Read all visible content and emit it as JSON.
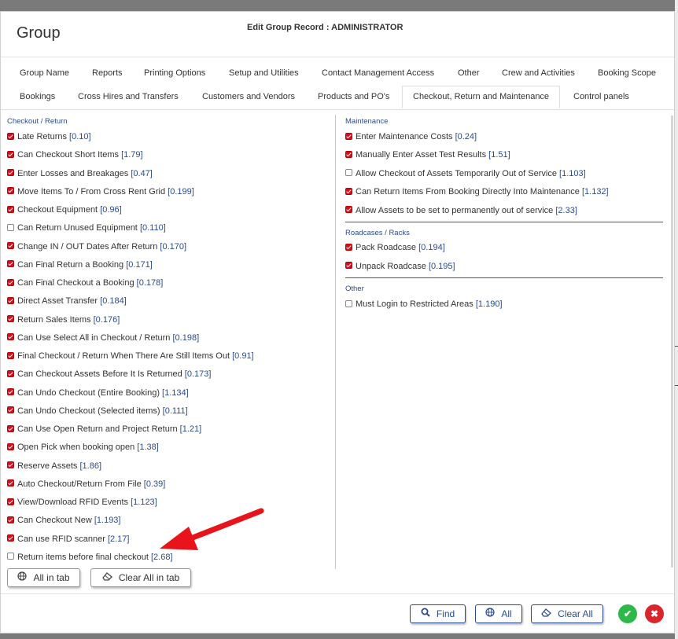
{
  "header": {
    "app_title": "Group",
    "record_title": "Edit Group Record : ADMINISTRATOR"
  },
  "tabs_row1": [
    {
      "label": "Group Name"
    },
    {
      "label": "Reports"
    },
    {
      "label": "Printing Options"
    },
    {
      "label": "Setup and Utilities"
    },
    {
      "label": "Contact Management Access"
    },
    {
      "label": "Other"
    },
    {
      "label": "Crew and Activities"
    },
    {
      "label": "Booking Scope"
    }
  ],
  "tabs_row2": [
    {
      "label": "Bookings"
    },
    {
      "label": "Cross Hires and Transfers"
    },
    {
      "label": "Customers and Vendors"
    },
    {
      "label": "Products and PO's"
    },
    {
      "label": "Checkout, Return and Maintenance",
      "active": true
    },
    {
      "label": "Control panels"
    }
  ],
  "left": {
    "section": "Checkout / Return",
    "items": [
      {
        "label": "Late Returns",
        "code": "[0.10]",
        "checked": true
      },
      {
        "label": "Can Checkout Short Items",
        "code": "[1.79]",
        "checked": true
      },
      {
        "label": "Enter Losses and Breakages",
        "code": "[0.47]",
        "checked": true
      },
      {
        "label": "Move Items To / From Cross Rent Grid",
        "code": "[0.199]",
        "checked": true
      },
      {
        "label": "Checkout Equipment",
        "code": "[0.96]",
        "checked": true
      },
      {
        "label": "Can Return Unused Equipment",
        "code": "[0.110]",
        "checked": false
      },
      {
        "label": "Change IN / OUT Dates After Return",
        "code": "[0.170]",
        "checked": true
      },
      {
        "label": "Can Final Return a Booking",
        "code": "[0.171]",
        "checked": true
      },
      {
        "label": "Can Final Checkout a Booking",
        "code": "[0.178]",
        "checked": true
      },
      {
        "label": "Direct Asset Transfer",
        "code": "[0.184]",
        "checked": true
      },
      {
        "label": "Return Sales Items",
        "code": "[0.176]",
        "checked": true
      },
      {
        "label": "Can Use Select All in Checkout / Return",
        "code": "[0.198]",
        "checked": true
      },
      {
        "label": "Final Checkout / Return When There Are Still Items Out",
        "code": "[0.91]",
        "checked": true
      },
      {
        "label": "Can Checkout Assets Before It Is Returned",
        "code": "[0.173]",
        "checked": true
      },
      {
        "label": "Can Undo Checkout (Entire Booking)",
        "code": "[1.134]",
        "checked": true
      },
      {
        "label": "Can Undo Checkout (Selected items)",
        "code": "[0.111]",
        "checked": true
      },
      {
        "label": "Can Use Open Return and Project Return",
        "code": "[1.21]",
        "checked": true
      },
      {
        "label": "Open Pick when booking open",
        "code": "[1.38]",
        "checked": true
      },
      {
        "label": "Reserve Assets",
        "code": "[1.86]",
        "checked": true
      },
      {
        "label": "Auto Checkout/Return From File",
        "code": "[0.39]",
        "checked": true
      },
      {
        "label": "View/Download RFID Events",
        "code": "[1.123]",
        "checked": true
      },
      {
        "label": "Can Checkout New",
        "code": "[1.193]",
        "checked": true
      },
      {
        "label": "Can use RFID scanner",
        "code": "[2.17]",
        "checked": true
      },
      {
        "label": "Return items before final checkout",
        "code": "[2.68]",
        "checked": false
      }
    ]
  },
  "right": {
    "maintenance": {
      "section": "Maintenance",
      "items": [
        {
          "label": "Enter Maintenance Costs",
          "code": "[0.24]",
          "checked": true
        },
        {
          "label": "Manually Enter Asset Test Results",
          "code": "[1.51]",
          "checked": true
        },
        {
          "label": "Allow Checkout of Assets Temporarily Out of Service",
          "code": "[1.103]",
          "checked": false
        },
        {
          "label": "Can Return Items From Booking Directly Into Maintenance",
          "code": "[1.132]",
          "checked": true
        },
        {
          "label": "Allow Assets to be set to permanently out of service",
          "code": "[2.33]",
          "checked": true
        }
      ]
    },
    "roadcases": {
      "section": "Roadcases / Racks",
      "items": [
        {
          "label": "Pack Roadcase",
          "code": "[0.194]",
          "checked": true
        },
        {
          "label": "Unpack Roadcase",
          "code": "[0.195]",
          "checked": true
        }
      ]
    },
    "other": {
      "section": "Other",
      "items": [
        {
          "label": "Must Login to Restricted Areas",
          "code": "[1.190]",
          "checked": false
        }
      ]
    }
  },
  "tab_buttons": {
    "all_label": "All in tab",
    "clear_label": "Clear All in tab"
  },
  "footer": {
    "find_label": "Find",
    "all_label": "All",
    "clear_label": "Clear All",
    "ok_symbol": "✔",
    "cancel_symbol": "✖"
  },
  "colors": {
    "accent_blue": "#2a4b8d",
    "checkbox_red": "#d2111d",
    "ok_green": "#2fb84a",
    "cancel_red": "#d9262c",
    "annotation_arrow": "#e8141c"
  },
  "icons": {
    "all_in_tab": "globe-icon",
    "clear_in_tab": "eraser-icon",
    "find": "search-icon",
    "all": "globe-icon",
    "clear_all": "eraser-icon",
    "ok": "check-icon",
    "cancel": "close-icon",
    "annotation": "red-arrow"
  }
}
